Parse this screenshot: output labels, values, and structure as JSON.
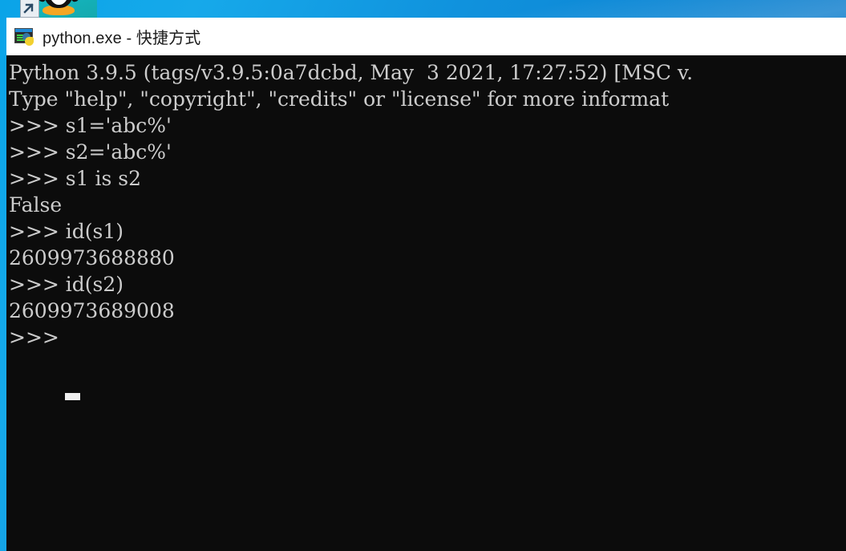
{
  "desktop": {
    "background_color": "#0d8ad6",
    "icon": {
      "name": "penguin-thumbnail-shortcut",
      "label": ""
    }
  },
  "window": {
    "title": "python.exe - 快捷方式",
    "title_icon": "python-console-icon",
    "background_color": "#0c0c0c",
    "text_color": "#cccccc",
    "titlebar_color": "#ffffff"
  },
  "console": {
    "lines": [
      "Python 3.9.5 (tags/v3.9.5:0a7dcbd, May  3 2021, 17:27:52) [MSC v. ",
      "Type \"help\", \"copyright\", \"credits\" or \"license\" for more informat",
      ">>> s1='abc%'",
      ">>> s2='abc%'",
      ">>> s1 is s2",
      "False",
      ">>> id(s1)",
      "2609973688880",
      ">>> id(s2)",
      "2609973689008",
      ">>> "
    ],
    "prompt": ">>>",
    "cursor_visible": true
  }
}
